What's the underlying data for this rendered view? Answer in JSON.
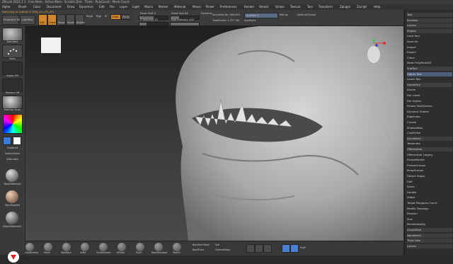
{
  "window": {
    "title": "ZBrush 2021.7.1 · Free Mem · Active Mem · Scratch Disk · Timer · PolyCount · Mesh Count",
    "status": "Switching to Subtool 3: EMA_Orc_FR_001"
  },
  "menu": [
    "Alpha",
    "Brush",
    "Color",
    "Document",
    "Draw",
    "Dynamics",
    "Edit",
    "File",
    "Layer",
    "Light",
    "Macro",
    "Marker",
    "Material",
    "Movie",
    "Picker",
    "Preferences",
    "Render",
    "Stencil",
    "Stroke",
    "Texture",
    "Tool",
    "Transform",
    "Zplugin",
    "Zscript",
    "Help"
  ],
  "toolbar": {
    "projection": "Projection Master",
    "lightbox": "LightBox",
    "edit": "Edit",
    "draw": "Draw",
    "move": "Move",
    "scale": "Scale",
    "rotate": "Rotate",
    "mrgb": "Mrgb",
    "rgb": "Rgb",
    "m": "M",
    "zadd": "Zadd",
    "zsub": "Zsub",
    "focal_shift": "Focal Shift 0",
    "draw_size": "Draw Size 64",
    "z_intensity": "Z Intensity 25",
    "dynamic": "Dynamic",
    "rgb_intensity": "Rgb Intensity 100",
    "active_points": "ActivePoints: 589,842",
    "total_points": "TotalPoints: 1.377 Mil",
    "subtool_field": "SubTool 3",
    "spotlight": "Spotlight",
    "menus": "Menus",
    "default_zscript": "DefaultZScript"
  },
  "left_shelf": {
    "items": [
      {
        "label": "Standard"
      },
      {
        "label": "Dots"
      },
      {
        "label": "Alpha Off"
      },
      {
        "label": "Texture Off"
      },
      {
        "label": "MatCap Gray"
      },
      {
        "label": "Gradient"
      },
      {
        "label": "SwitchColor"
      },
      {
        "label": "Alternate"
      }
    ],
    "swatch_colors": {
      "main": "#3b7ad8",
      "secondary": "#ffffff"
    },
    "bottom_labels": [
      "BasicMaterial",
      "SkinShade4",
      "BasicMaterial2"
    ]
  },
  "right_panel": {
    "items": [
      {
        "label": "Tool"
      },
      {
        "label": "Brushes"
      },
      {
        "label": "Layers"
      },
      {
        "label": "Project"
      },
      {
        "label": "Load Tool"
      },
      {
        "label": "Save As"
      },
      {
        "label": "Import"
      },
      {
        "label": "Export"
      },
      {
        "label": "Clone"
      },
      {
        "label": "Make PolyMesh3D"
      },
      {
        "label": "SubTool"
      },
      {
        "label": "Higher Res"
      },
      {
        "label": "Lower Res"
      },
      {
        "label": "Geometry"
      },
      {
        "label": "Divide"
      },
      {
        "label": "Del Lower"
      },
      {
        "label": "Del Higher"
      },
      {
        "label": "Freeze SubDivision"
      },
      {
        "label": "Dynamic Subdiv"
      },
      {
        "label": "EdgeLoop"
      },
      {
        "label": "Crease"
      },
      {
        "label": "ShadowBox"
      },
      {
        "label": "ClayPolish"
      },
      {
        "label": "DynaMesh"
      },
      {
        "label": "Tessimate"
      },
      {
        "label": "ZRemesher"
      },
      {
        "label": "ZRemesher Legacy"
      },
      {
        "label": "FreezeBorder"
      },
      {
        "label": "FreezeGroups"
      },
      {
        "label": "KeepGroups"
      },
      {
        "label": "Detect Edges"
      },
      {
        "label": "Half"
      },
      {
        "label": "Same"
      },
      {
        "label": "Double"
      },
      {
        "label": "Adapt"
      },
      {
        "label": "Target Polygons Count"
      },
      {
        "label": "Modify Topology"
      },
      {
        "label": "Position"
      },
      {
        "label": "Size"
      },
      {
        "label": "MeshIntegrity"
      },
      {
        "label": "ArrayMesh"
      },
      {
        "label": "NanoMesh"
      },
      {
        "label": "Thick Skin"
      },
      {
        "label": "Layers"
      }
    ]
  },
  "bottom_shelf": {
    "brushes": [
      "ClayBuildup",
      "Move",
      "Standard",
      "Inflat",
      "TrimDynamic",
      "hPolish",
      "Pinch",
      "DamStandard",
      "Slash3"
    ],
    "controls": [
      "Backface Mask",
      "BackTrans",
      "Sub",
      "ColorizeMask"
    ],
    "readout": "PolyF"
  }
}
